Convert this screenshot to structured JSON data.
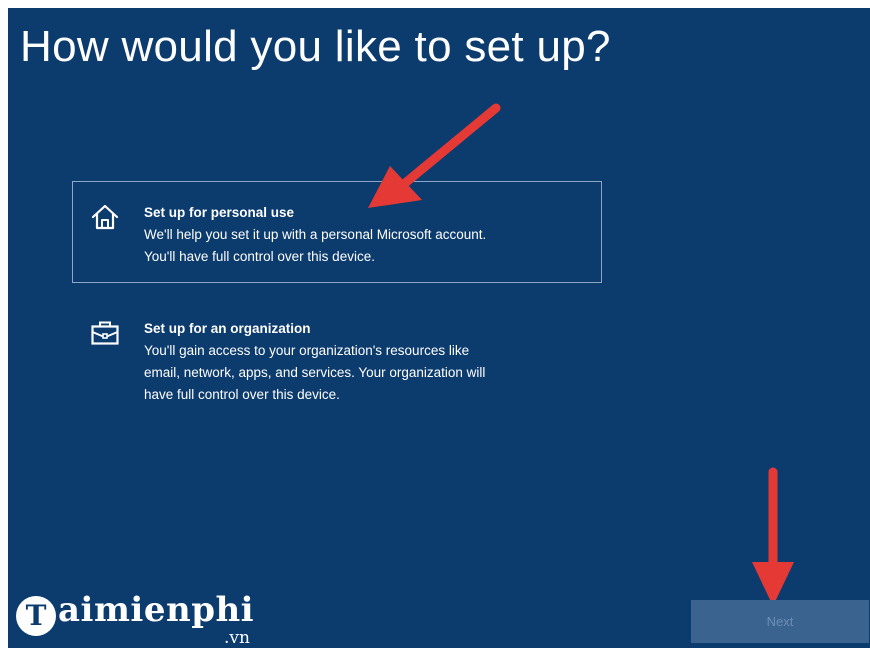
{
  "header": {
    "title": "How would you like to set up?"
  },
  "options": [
    {
      "title": "Set up for personal use",
      "description_lines": [
        "We'll help you set it up with a personal Microsoft account.",
        "You'll have full control over this device."
      ],
      "icon": "home-icon",
      "selected": true
    },
    {
      "title": "Set up for an organization",
      "description_lines": [
        "You'll gain access to your organization's resources like",
        "email, network, apps, and services. Your organization will",
        "have full control over this device."
      ],
      "icon": "briefcase-icon",
      "selected": false
    }
  ],
  "footer": {
    "next_label": "Next"
  },
  "watermark": {
    "text": "aimienphi",
    "badge_letter": "T",
    "suffix": ".vn"
  },
  "colors": {
    "background": "#0c3b6e",
    "next_button": "#3a6390",
    "annotation_arrow": "#e53935"
  }
}
